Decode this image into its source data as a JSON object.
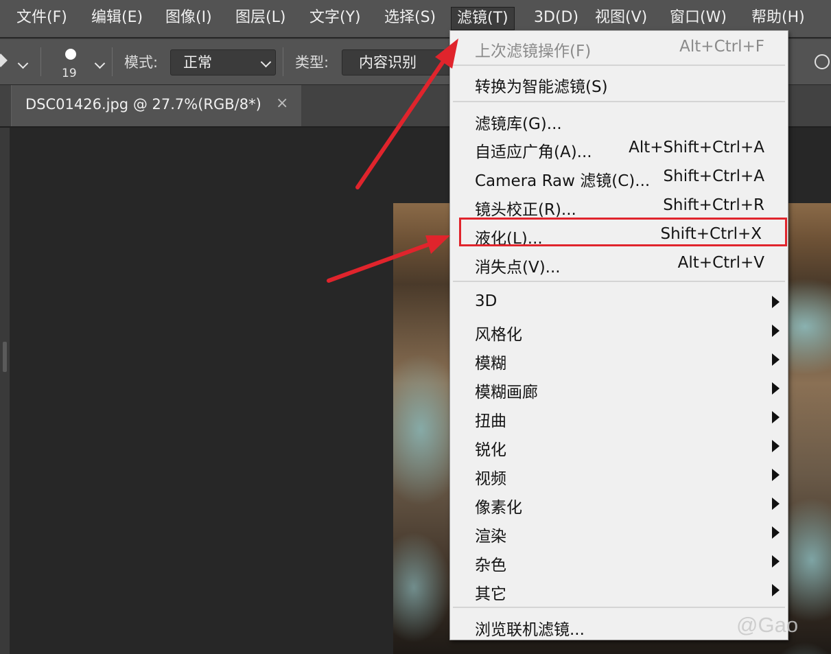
{
  "menubar": {
    "items": [
      "文件(F)",
      "编辑(E)",
      "图像(I)",
      "图层(L)",
      "文字(Y)",
      "选择(S)",
      "滤镜(T)",
      "3D(D)",
      "视图(V)",
      "窗口(W)",
      "帮助(H)"
    ],
    "active_index": 6
  },
  "options": {
    "brush_size": "19",
    "mode_label": "模式:",
    "mode_value": "正常",
    "type_label": "类型:",
    "type_value": "内容识别"
  },
  "document": {
    "tab_title": "DSC01426.jpg @ 27.7%(RGB/8*)",
    "close_glyph": "×"
  },
  "filter_menu": {
    "items": [
      {
        "label": "上次滤镜操作(F)",
        "shortcut": "Alt+Ctrl+F",
        "disabled": true
      },
      {
        "label": "转换为智能滤镜(S)",
        "shortcut": ""
      },
      {
        "label": "滤镜库(G)...",
        "shortcut": ""
      },
      {
        "label": "自适应广角(A)...",
        "shortcut": "Alt+Shift+Ctrl+A"
      },
      {
        "label": "Camera Raw 滤镜(C)...",
        "shortcut": "Shift+Ctrl+A"
      },
      {
        "label": "镜头校正(R)...",
        "shortcut": "Shift+Ctrl+R"
      },
      {
        "label": "液化(L)...",
        "shortcut": "Shift+Ctrl+X",
        "highlighted": true
      },
      {
        "label": "消失点(V)...",
        "shortcut": "Alt+Ctrl+V"
      },
      {
        "label": "3D",
        "submenu": true
      },
      {
        "label": "风格化",
        "submenu": true
      },
      {
        "label": "模糊",
        "submenu": true
      },
      {
        "label": "模糊画廊",
        "submenu": true
      },
      {
        "label": "扭曲",
        "submenu": true
      },
      {
        "label": "锐化",
        "submenu": true
      },
      {
        "label": "视频",
        "submenu": true
      },
      {
        "label": "像素化",
        "submenu": true
      },
      {
        "label": "渲染",
        "submenu": true
      },
      {
        "label": "杂色",
        "submenu": true
      },
      {
        "label": "其它",
        "submenu": true
      },
      {
        "label": "浏览联机滤镜...",
        "shortcut": ""
      }
    ]
  },
  "watermark": "@Gao",
  "colors": {
    "annotation_red": "#e0242c",
    "menu_bg": "#f0f0f0",
    "chrome_bg": "#535353"
  }
}
